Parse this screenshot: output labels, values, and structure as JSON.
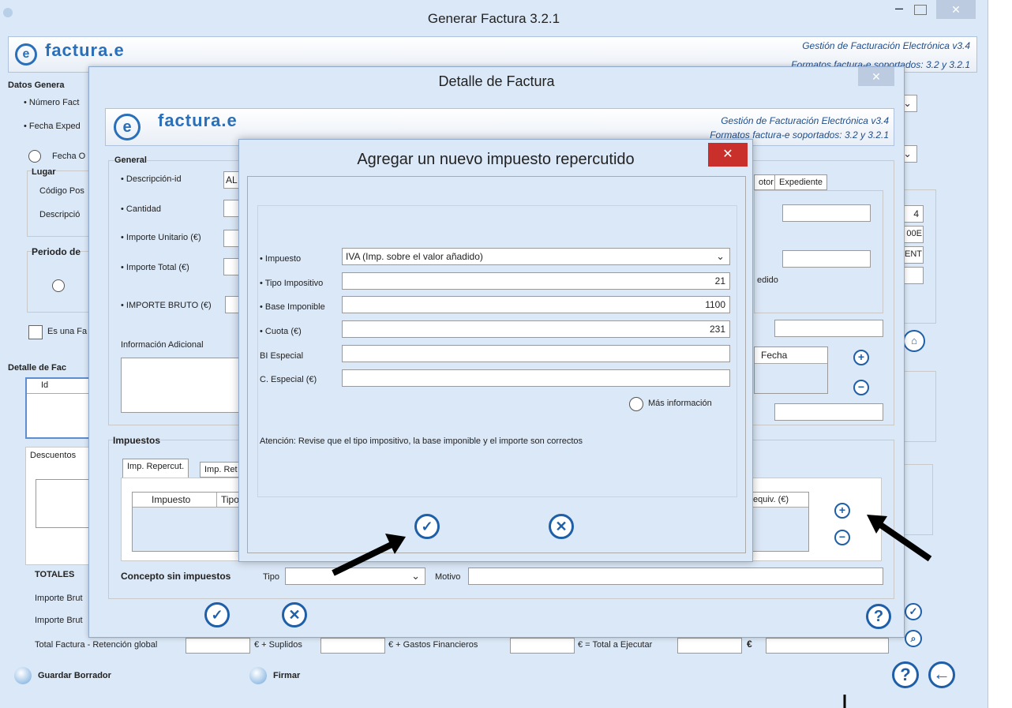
{
  "main_window": {
    "title": "Generar Factura 3.2.1",
    "logo_text": "factura.e",
    "subtitle1": "Gestión de Facturación Electrónica v3.4",
    "subtitle2": "Formatos factura-e soportados: 3.2 y 3.2.1",
    "datos_generales": "Datos Genera",
    "numero_factura": "• Número Fact",
    "fecha_expedicion": "• Fecha Exped",
    "fecha_radio": "Fecha O",
    "lugar": "Lugar",
    "codigo_postal": "Código Pos",
    "descripcion": "Descripció",
    "periodo": "Periodo de",
    "es_una": "Es una Fa",
    "detalle_factura": "Detalle de Fac",
    "id_col": "Id",
    "descuentos": "Descuentos",
    "totales": "TOTALES",
    "importe_bruto1": "Importe Brut",
    "importe_bruto2": "Importe Brut",
    "total_factura": "Total Factura  -  Retención global",
    "suplidos": "€  +  Suplidos",
    "gastos": "€  +  Gastos Financieros",
    "total_ejecutar": "€  =  Total a Ejecutar",
    "euro": "€",
    "guardar_borrador": "Guardar Borrador",
    "firmar": "Firmar",
    "right_vals": [
      "4",
      "00E",
      "ENT"
    ]
  },
  "detalle_window": {
    "title": "Detalle de Factura",
    "logo_text": "factura.e",
    "subtitle1": "Gestión de Facturación Electrónica v3.4",
    "subtitle2": "Formatos factura-e soportados: 3.2 y 3.2.1",
    "general": "General",
    "descripcion_id": "• Descripción-id",
    "descripcion_val": "AL",
    "cantidad": "• Cantidad",
    "importe_unitario": "• Importe Unitario (€)",
    "importe_total": "• Importe Total (€)",
    "importe_bruto": "• IMPORTE BRUTO (€)",
    "info_adicional": "Información Adicional",
    "tab_otor": "otor",
    "tab_expediente": "Expediente",
    "edido": "edido",
    "fecha_col": "Fecha",
    "impuestos": "Impuestos",
    "tab_repercut": "Imp. Repercut.",
    "tab_ret": "Imp. Ret",
    "col_impuesto": "Impuesto",
    "col_tipo": "Tipo",
    "col_equiv": "equiv. (€)",
    "concepto": "Concepto sin impuestos",
    "tipo": "Tipo",
    "motivo": "Motivo"
  },
  "dialog": {
    "title": "Agregar un nuevo impuesto repercutido",
    "impuesto_label": "• Impuesto",
    "impuesto_value": "IVA (Imp. sobre el valor añadido)",
    "tipo_label": "• Tipo Impositivo",
    "tipo_value": "21",
    "base_label": "• Base Imponible",
    "base_value": "1100",
    "cuota_label": "• Cuota (€)",
    "cuota_value": "231",
    "bi_especial_label": "BI Especial",
    "c_especial_label": "C. Especial (€)",
    "mas_info": "Más información",
    "atencion": "Atención: Revise que el tipo impositivo, la base imponible y el importe son correctos"
  },
  "colors": {
    "accent": "#1f5fa8",
    "close_red": "#c9302c",
    "window_bg": "#dbe8f7"
  }
}
